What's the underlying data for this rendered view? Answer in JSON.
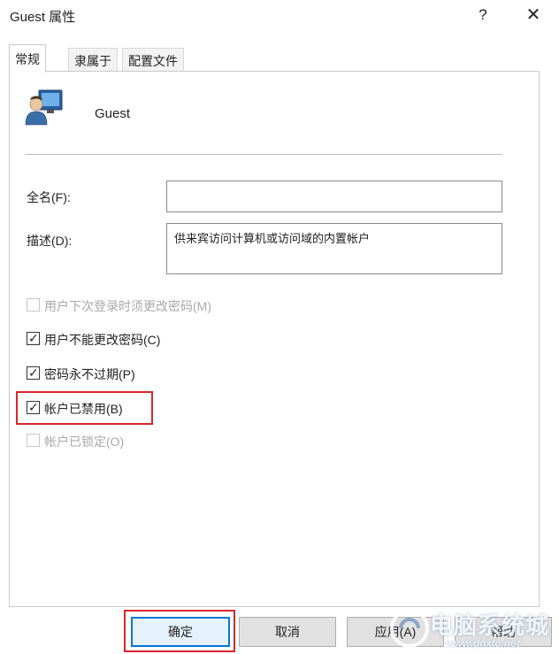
{
  "window": {
    "title": "Guest 属性",
    "help_glyph": "?",
    "close_glyph": "✕"
  },
  "tabs": [
    {
      "label": "常规",
      "active": true
    },
    {
      "label": "隶属于",
      "active": false
    },
    {
      "label": "配置文件",
      "active": false
    }
  ],
  "user": {
    "name": "Guest",
    "icon": "user-monitor-icon"
  },
  "fields": {
    "fullname_label": "全名(F):",
    "fullname_value": "",
    "description_label": "描述(D):",
    "description_value": "供来宾访问计算机或访问域的内置帐户"
  },
  "checkboxes": [
    {
      "label": "用户下次登录时须更改密码(M)",
      "checked": false,
      "enabled": false
    },
    {
      "label": "用户不能更改密码(C)",
      "checked": true,
      "enabled": true
    },
    {
      "label": "密码永不过期(P)",
      "checked": true,
      "enabled": true
    },
    {
      "label": "帐户已禁用(B)",
      "checked": true,
      "enabled": true
    },
    {
      "label": "帐户已锁定(O)",
      "checked": false,
      "enabled": false
    }
  ],
  "buttons": {
    "ok": "确定",
    "cancel": "取消",
    "apply": "应用(A)",
    "help": "帮助"
  },
  "watermark": {
    "text": "电脑系统城",
    "url": "www.dnxtc.net"
  },
  "colors": {
    "highlight": "#d9262c",
    "primary_border": "#0078d7"
  }
}
